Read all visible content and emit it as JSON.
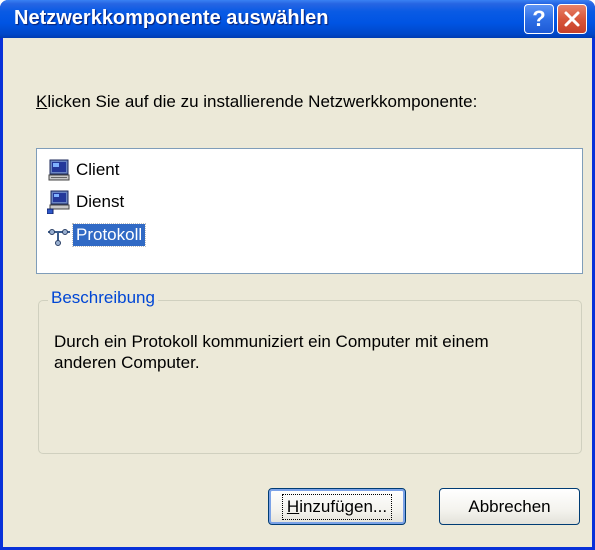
{
  "window": {
    "title": "Netzwerkkomponente auswählen"
  },
  "titlebar": {
    "help_icon": "help-icon",
    "close_icon": "close-icon"
  },
  "instruction": {
    "accel": "K",
    "rest": "licken Sie auf die zu installierende Netzwerkkomponente:"
  },
  "components": [
    {
      "label": "Client",
      "icon": "client-computer-icon",
      "selected": false
    },
    {
      "label": "Dienst",
      "icon": "service-computer-icon",
      "selected": false
    },
    {
      "label": "Protokoll",
      "icon": "protocol-network-icon",
      "selected": true
    }
  ],
  "description": {
    "title": "Beschreibung",
    "text": "Durch ein Protokoll kommuniziert ein Computer mit einem anderen Computer."
  },
  "buttons": {
    "add_accel": "H",
    "add_rest": "inzufügen...",
    "cancel": "Abbrechen"
  },
  "colors": {
    "titlebar": "#0054e3",
    "dialog_bg": "#ece9d8",
    "selection": "#316ac5",
    "group_title": "#0046d5",
    "close_button": "#d8573b"
  }
}
